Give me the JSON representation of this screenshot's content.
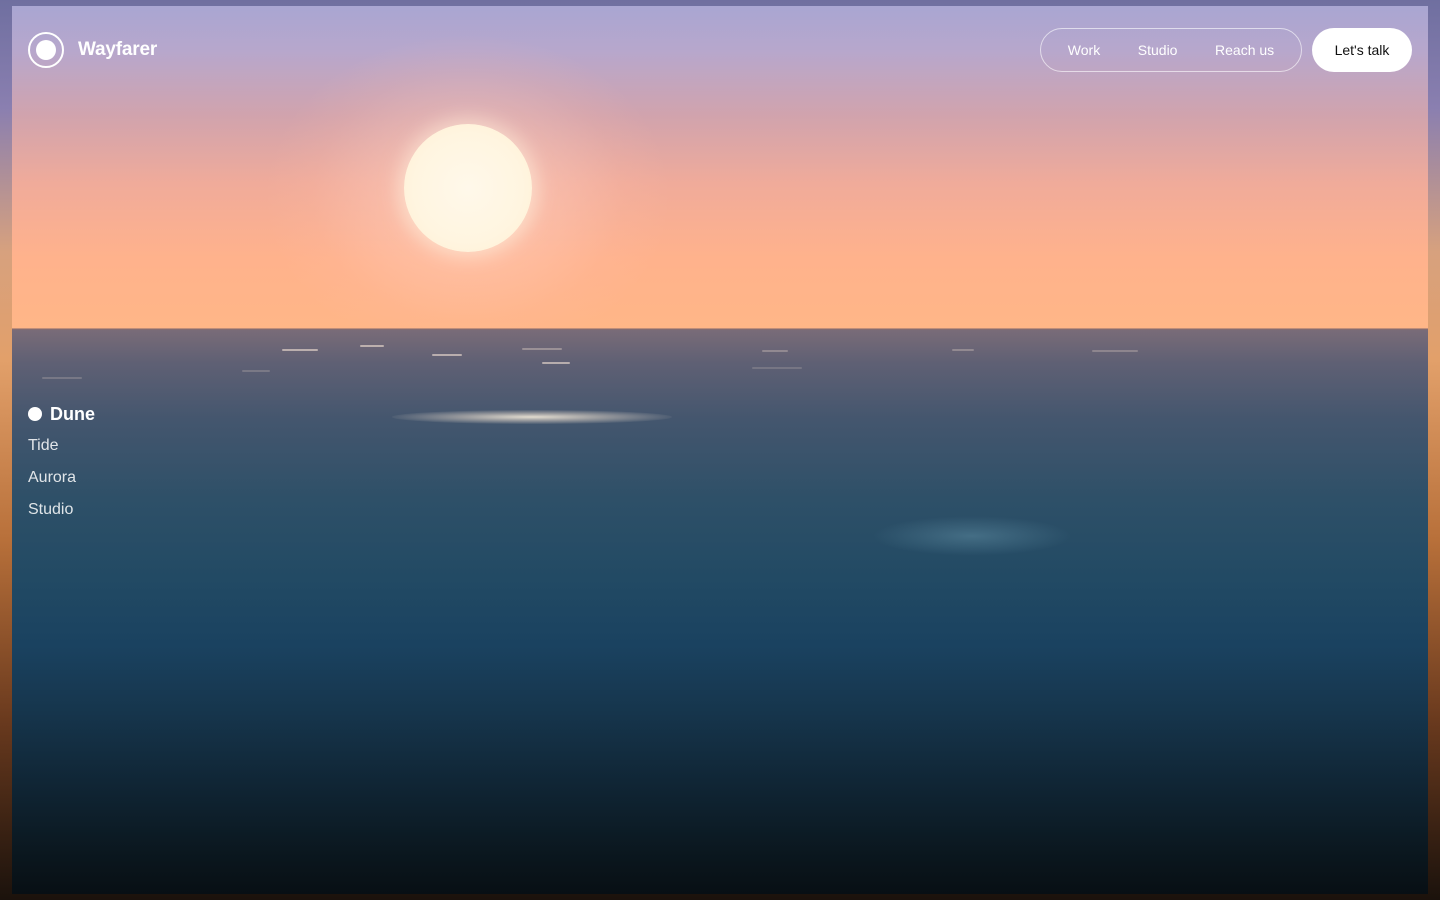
{
  "brand": {
    "name": "Wayfarer",
    "logo_icon": "ring-dot-logo-icon"
  },
  "nav": {
    "links": [
      {
        "label": "Work"
      },
      {
        "label": "Studio"
      },
      {
        "label": "Reach us"
      }
    ],
    "cta_label": "Let's talk"
  },
  "sections": {
    "active_index": 0,
    "items": [
      {
        "label": "Dune"
      },
      {
        "label": "Tide"
      },
      {
        "label": "Aurora"
      },
      {
        "label": "Studio"
      }
    ]
  },
  "colors": {
    "text": "#ffffff",
    "cta_background": "#ffffff",
    "cta_text": "#111111",
    "sky_top": "#a9a6d2",
    "sky_horizon": "#ffb687",
    "sea_top": "#7a6c78",
    "sea_bottom": "#080f14",
    "sun": "#fff5e0"
  }
}
